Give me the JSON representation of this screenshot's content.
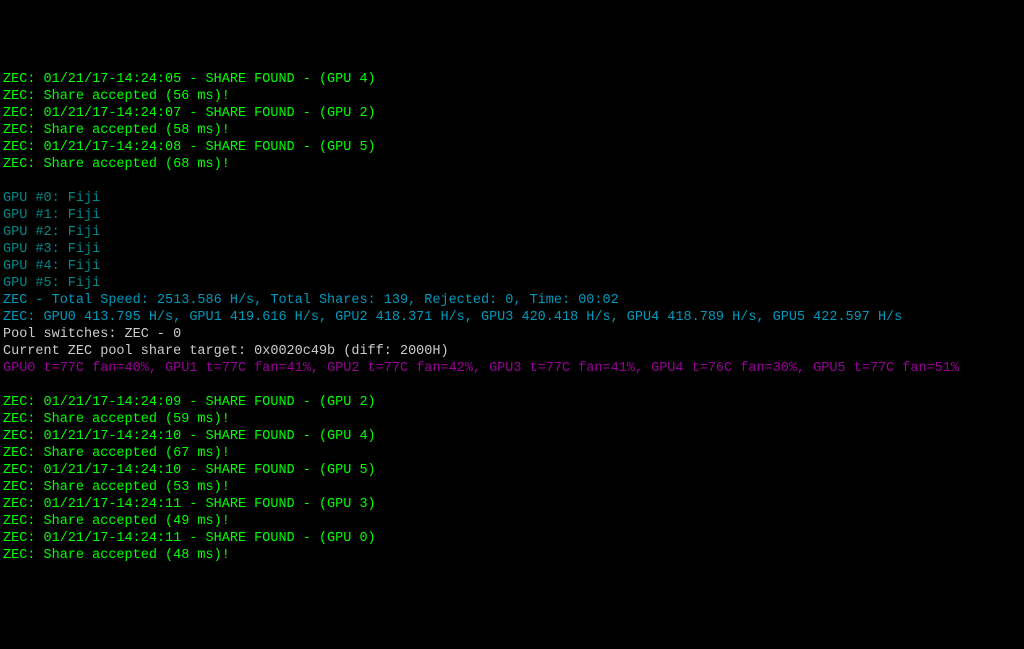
{
  "lines": [
    {
      "color": "green",
      "text": "ZEC: 01/21/17-14:24:05 - SHARE FOUND - (GPU 4)"
    },
    {
      "color": "green",
      "text": "ZEC: Share accepted (56 ms)!"
    },
    {
      "color": "green",
      "text": "ZEC: 01/21/17-14:24:07 - SHARE FOUND - (GPU 2)"
    },
    {
      "color": "green",
      "text": "ZEC: Share accepted (58 ms)!"
    },
    {
      "color": "green",
      "text": "ZEC: 01/21/17-14:24:08 - SHARE FOUND - (GPU 5)"
    },
    {
      "color": "green",
      "text": "ZEC: Share accepted (68 ms)!"
    },
    {
      "color": "",
      "text": ""
    },
    {
      "color": "teal",
      "text": "GPU #0: Fiji"
    },
    {
      "color": "teal",
      "text": "GPU #1: Fiji"
    },
    {
      "color": "teal",
      "text": "GPU #2: Fiji"
    },
    {
      "color": "teal",
      "text": "GPU #3: Fiji"
    },
    {
      "color": "teal",
      "text": "GPU #4: Fiji"
    },
    {
      "color": "teal",
      "text": "GPU #5: Fiji"
    },
    {
      "color": "cyan",
      "text": "ZEC - Total Speed: 2513.586 H/s, Total Shares: 139, Rejected: 0, Time: 00:02"
    },
    {
      "color": "cyan",
      "text": "ZEC: GPU0 413.795 H/s, GPU1 419.616 H/s, GPU2 418.371 H/s, GPU3 420.418 H/s, GPU4 418.789 H/s, GPU5 422.597 H/s"
    },
    {
      "color": "white",
      "text": "Pool switches: ZEC - 0"
    },
    {
      "color": "white",
      "text": "Current ZEC pool share target: 0x0020c49b (diff: 2000H)"
    },
    {
      "color": "purple",
      "text": "GPU0 t=77C fan=40%, GPU1 t=77C fan=41%, GPU2 t=77C fan=42%, GPU3 t=77C fan=41%, GPU4 t=76C fan=30%, GPU5 t=77C fan=51%"
    },
    {
      "color": "",
      "text": ""
    },
    {
      "color": "green",
      "text": "ZEC: 01/21/17-14:24:09 - SHARE FOUND - (GPU 2)"
    },
    {
      "color": "green",
      "text": "ZEC: Share accepted (59 ms)!"
    },
    {
      "color": "green",
      "text": "ZEC: 01/21/17-14:24:10 - SHARE FOUND - (GPU 4)"
    },
    {
      "color": "green",
      "text": "ZEC: Share accepted (67 ms)!"
    },
    {
      "color": "green",
      "text": "ZEC: 01/21/17-14:24:10 - SHARE FOUND - (GPU 5)"
    },
    {
      "color": "green",
      "text": "ZEC: Share accepted (53 ms)!"
    },
    {
      "color": "green",
      "text": "ZEC: 01/21/17-14:24:11 - SHARE FOUND - (GPU 3)"
    },
    {
      "color": "green",
      "text": "ZEC: Share accepted (49 ms)!"
    },
    {
      "color": "green",
      "text": "ZEC: 01/21/17-14:24:11 - SHARE FOUND - (GPU 0)"
    },
    {
      "color": "green",
      "text": "ZEC: Share accepted (48 ms)!"
    }
  ]
}
